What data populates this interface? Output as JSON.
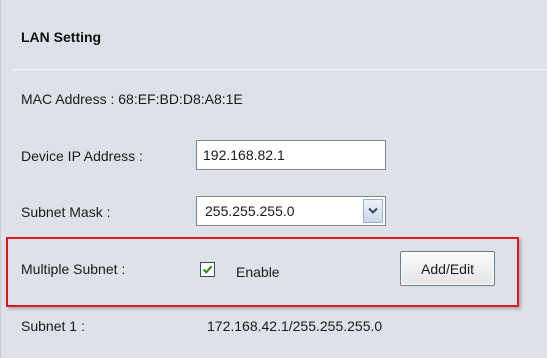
{
  "lan_setting": {
    "title": "LAN Setting",
    "mac_address_label": "MAC Address : 68:EF:BD:D8:A8:1E",
    "device_ip_label": "Device IP Address :",
    "device_ip_value": "192.168.82.1",
    "subnet_mask_label": "Subnet Mask :",
    "subnet_mask_value": "255.255.255.0",
    "subnet_mask_arrow_icon": "chevron-down-icon",
    "multiple_subnet_label": "Multiple Subnet :",
    "enable_checked": true,
    "enable_label": "Enable",
    "add_edit_label": "Add/Edit",
    "subnet1_label": "Subnet 1 :",
    "subnet1_value": "172.168.42.1/255.255.255.0"
  },
  "colors": {
    "panel_background": "#dde2e8",
    "highlight_border": "#e0191f",
    "check_color": "#1f8a1f"
  }
}
